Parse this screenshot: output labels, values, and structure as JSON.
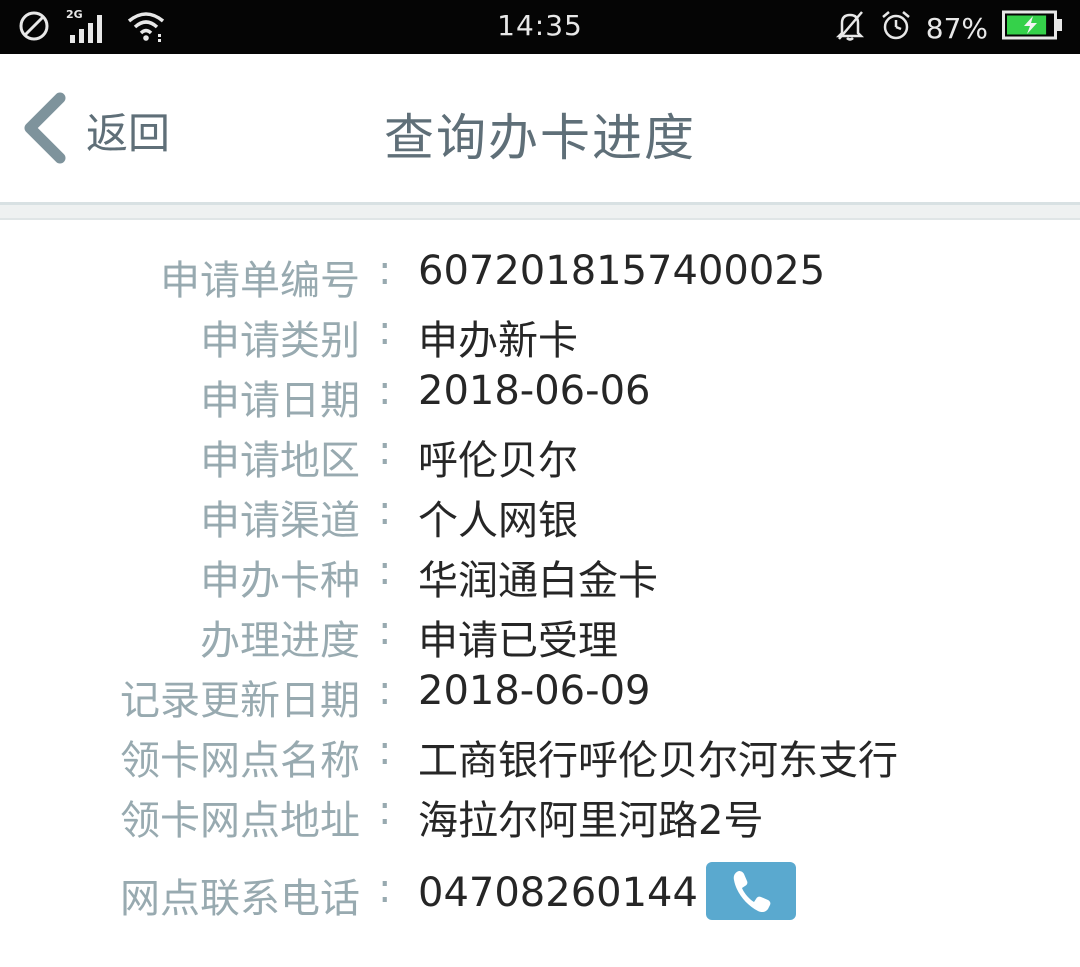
{
  "status_bar": {
    "network_type": "2G",
    "time": "14:35",
    "battery_percent": "87%"
  },
  "header": {
    "back_label": "返回",
    "title": "查询办卡进度"
  },
  "details": [
    {
      "label": "申请单编号",
      "value": "6072018157400025"
    },
    {
      "label": "申请类别",
      "value": "申办新卡"
    },
    {
      "label": "申请日期",
      "value": "2018-06-06"
    },
    {
      "label": "申请地区",
      "value": "呼伦贝尔"
    },
    {
      "label": "申请渠道",
      "value": "个人网银"
    },
    {
      "label": "申办卡种",
      "value": "华润通白金卡"
    },
    {
      "label": "办理进度",
      "value": "申请已受理"
    },
    {
      "label": "记录更新日期",
      "value": "2018-06-09"
    },
    {
      "label": "领卡网点名称",
      "value": "工商银行呼伦贝尔河东支行"
    },
    {
      "label": "领卡网点地址",
      "value": "海拉尔阿里河路2号"
    },
    {
      "label": "网点联系电话",
      "value": "04708260144"
    }
  ],
  "separator": ":",
  "colors": {
    "status_bar_bg": "#050505",
    "header_text": "#5f6f78",
    "label_text": "#98aab0",
    "value_text": "#262626",
    "call_button": "#5aa9cf",
    "battery_fill": "#35d14a"
  },
  "icons": {
    "sim": "no-sim-icon",
    "signal": "signal-icon",
    "wifi": "wifi-icon",
    "mute": "bell-off-icon",
    "alarm": "alarm-icon",
    "battery": "battery-charging-icon",
    "back": "chevron-left-icon",
    "phone": "phone-icon"
  }
}
